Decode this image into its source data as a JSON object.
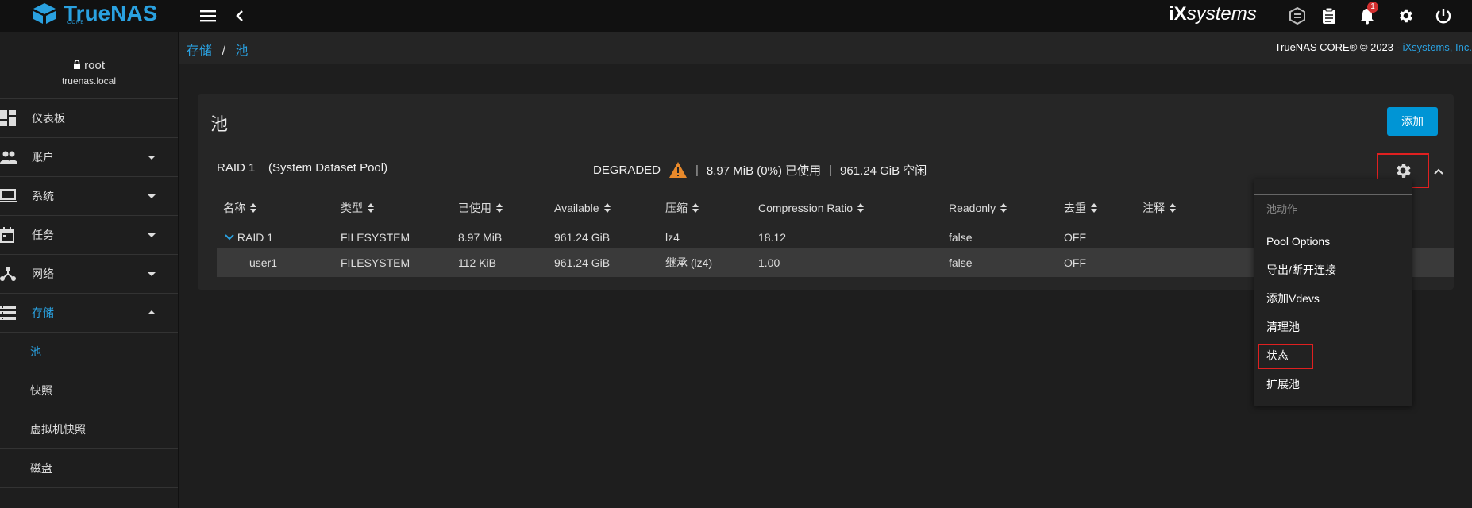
{
  "brand": {
    "name": "TrueNAS",
    "edition": "CORE",
    "vendor_a": "iX",
    "vendor_b": "systems"
  },
  "notifications": {
    "count": "1"
  },
  "user": {
    "name": "root",
    "host": "truenas.local"
  },
  "sidebar": {
    "items": [
      {
        "label": "仪表板",
        "icon": "dashboard-icon"
      },
      {
        "label": "账户",
        "icon": "accounts-icon"
      },
      {
        "label": "系统",
        "icon": "system-icon"
      },
      {
        "label": "任务",
        "icon": "tasks-icon"
      },
      {
        "label": "网络",
        "icon": "network-icon"
      },
      {
        "label": "存储",
        "icon": "storage-icon"
      }
    ],
    "sub_items": [
      "池",
      "快照",
      "虚拟机快照",
      "磁盘"
    ]
  },
  "breadcrumb": {
    "parent": "存储",
    "separator": "/",
    "current": "池"
  },
  "copyright": {
    "text": "TrueNAS CORE® © 2023 - ",
    "link": "iXsystems, Inc."
  },
  "card": {
    "title": "池",
    "add_label": "添加"
  },
  "pool": {
    "name": "RAID 1",
    "note": "(System Dataset Pool)",
    "state": "DEGRADED",
    "sep": "|",
    "used": "8.97 MiB (0%) 已使用",
    "free": "961.24 GiB 空闲"
  },
  "table": {
    "headers": [
      "名称",
      "类型",
      "已使用",
      "Available",
      "压缩",
      "Compression Ratio",
      "Readonly",
      "去重",
      "注释"
    ],
    "rows": [
      {
        "name": "RAID 1",
        "type": "FILESYSTEM",
        "used": "8.97 MiB",
        "available": "961.24 GiB",
        "compression": "lz4",
        "ratio": "18.12",
        "readonly": "false",
        "dedup": "OFF"
      },
      {
        "name": "user1",
        "type": "FILESYSTEM",
        "used": "112 KiB",
        "available": "961.24 GiB",
        "compression": "继承 (lz4)",
        "ratio": "1.00",
        "readonly": "false",
        "dedup": "OFF"
      }
    ]
  },
  "menu": {
    "header": "池动作",
    "items": [
      "Pool Options",
      "导出/断开连接",
      "添加Vdevs",
      "清理池",
      "状态",
      "扩展池"
    ]
  },
  "colors": {
    "accent": "#2aa1e0",
    "button": "#0095d5",
    "warning": "#e8892b",
    "highlight": "#e02020"
  }
}
